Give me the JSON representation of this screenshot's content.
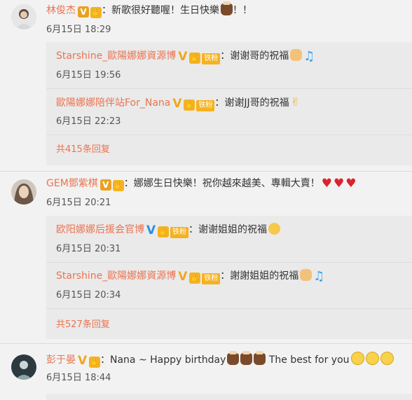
{
  "comments": [
    {
      "user": "林俊杰",
      "text": "：新歌很好聽喔！生日快樂",
      "text_tail": "！！",
      "time": "6月15日 18:29",
      "replies": [
        {
          "user": "Starshine_歐陽娜娜資源博",
          "fan": "铁粉",
          "text": "：谢谢哥的祝福",
          "time": "6月15日 19:56"
        },
        {
          "user": "歐陽娜娜陪伴站For_Nana",
          "fan": "铁粉",
          "text": "：谢谢JJ哥的祝福",
          "time": "6月15日 22:23"
        }
      ],
      "more": "共415条回复"
    },
    {
      "user": "GEM鄧紫棋",
      "text": "：娜娜生日快樂！祝你越來越美、專輯大賣！",
      "time": "6月15日 20:21",
      "replies": [
        {
          "user": "欧阳娜娜后援会官博",
          "fan": "铁粉",
          "text": "：谢谢姐姐的祝福",
          "time": "6月15日 20:31"
        },
        {
          "user": "Starshine_歐陽娜娜資源博",
          "fan": "铁粉",
          "text": "：謝謝姐姐的祝福",
          "time": "6月15日 20:34"
        }
      ],
      "more": "共527条回复"
    },
    {
      "user": "彭于晏",
      "text": "：Nana ~ Happy birthday",
      "text_tail": " The best for you",
      "time": "6月15日 18:44"
    }
  ],
  "icons": {
    "verified_orange": "V",
    "verified_blue": "V",
    "hand_glyph": "✋"
  },
  "colors": {
    "username": "#eb7350",
    "verified_orange": "#e8a21f",
    "verified_blue": "#2b8fe8",
    "fan_badge": "#f5b21f"
  }
}
